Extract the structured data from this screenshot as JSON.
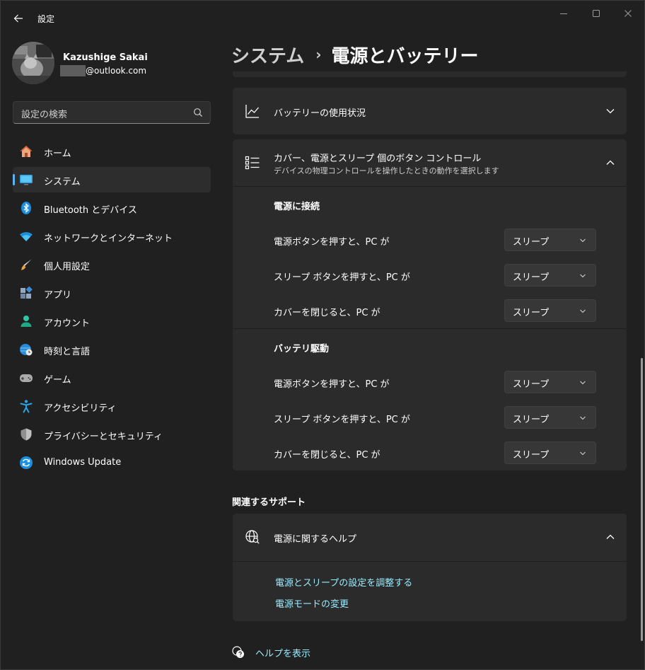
{
  "titlebar": {
    "title": "設定"
  },
  "profile": {
    "name": "Kazushige Sakai",
    "email_suffix": "@outlook.com"
  },
  "search": {
    "placeholder": "設定の検索"
  },
  "nav": {
    "items": [
      {
        "label": "ホーム",
        "icon": "home-icon"
      },
      {
        "label": "システム",
        "icon": "system-icon",
        "selected": true
      },
      {
        "label": "Bluetooth とデバイス",
        "icon": "bluetooth-icon"
      },
      {
        "label": "ネットワークとインターネット",
        "icon": "wifi-icon"
      },
      {
        "label": "個人用設定",
        "icon": "brush-icon"
      },
      {
        "label": "アプリ",
        "icon": "apps-icon"
      },
      {
        "label": "アカウント",
        "icon": "account-icon"
      },
      {
        "label": "時刻と言語",
        "icon": "globe-clock-icon"
      },
      {
        "label": "ゲーム",
        "icon": "gamepad-icon"
      },
      {
        "label": "アクセシビリティ",
        "icon": "accessibility-icon"
      },
      {
        "label": "プライバシーとセキュリティ",
        "icon": "shield-icon"
      },
      {
        "label": "Windows Update",
        "icon": "update-icon"
      }
    ]
  },
  "breadcrumb": {
    "parent": "システム",
    "separator": "›",
    "current": "電源とバッテリー"
  },
  "battery_usage": {
    "title": "バッテリーの使用状況"
  },
  "lid_buttons": {
    "title": "カバー、電源とスリープ 個のボタン コントロール",
    "subtitle": "デバイスの物理コントロールを操作したときの動作を選択します",
    "plugged_in": {
      "heading": "電源に接続",
      "rows": [
        {
          "label": "電源ボタンを押すと、PC が",
          "value": "スリープ"
        },
        {
          "label": "スリープ ボタンを押すと、PC が",
          "value": "スリープ"
        },
        {
          "label": "カバーを閉じると、PC が",
          "value": "スリープ"
        }
      ]
    },
    "on_battery": {
      "heading": "バッテリ駆動",
      "rows": [
        {
          "label": "電源ボタンを押すと、PC が",
          "value": "スリープ"
        },
        {
          "label": "スリープ ボタンを押すと、PC が",
          "value": "スリープ"
        },
        {
          "label": "カバーを閉じると、PC が",
          "value": "スリープ"
        }
      ]
    }
  },
  "support": {
    "heading": "関連するサポート",
    "help_title": "電源に関するヘルプ",
    "links": [
      "電源とスリープの設定を調整する",
      "電源モードの変更"
    ]
  },
  "footer": {
    "help_link": "ヘルプを表示"
  },
  "colors": {
    "background": "#202020",
    "card": "#2b2b2b",
    "accent": "#5fb2f2",
    "link": "#99ebff"
  }
}
